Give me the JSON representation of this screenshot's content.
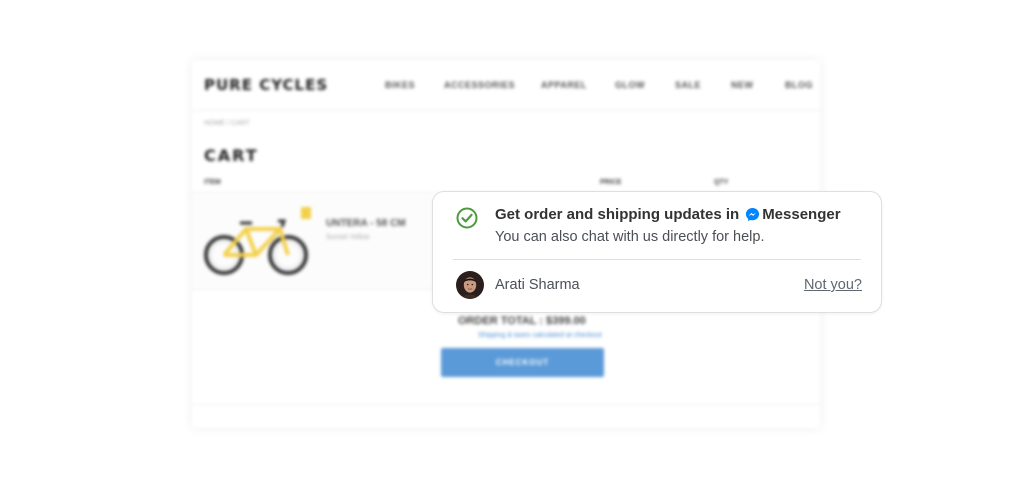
{
  "shop": {
    "logo": "PURE CYCLES",
    "nav": [
      "BIKES",
      "ACCESSORIES",
      "APPAREL",
      "GLOW",
      "SALE",
      "NEW",
      "BLOG"
    ],
    "breadcrumb": "HOME  /  CART",
    "cart_title": "CART",
    "columns": [
      "ITEM",
      "PRICE",
      "QTY"
    ],
    "item": {
      "name": "UNTERA - 58 CM",
      "sub": "Sunset Yellow",
      "frame_color": "#f3d04a"
    },
    "order_total": "ORDER TOTAL : $399.00",
    "shipping_note": "Shipping & taxes calculated at checkout",
    "checkout_label": "CHECKOUT",
    "accent_color": "#5b9ad8"
  },
  "optin": {
    "headline_prefix": "Get order and shipping updates in",
    "headline_brand": "Messenger",
    "subline": "You can also chat with us directly for help.",
    "user_name": "Arati Sharma",
    "not_you_label": "Not you?",
    "check_icon": "check-circle-icon",
    "brand_icon": "messenger-icon",
    "check_color": "#4c9a3d",
    "messenger_color": "#0084ff"
  }
}
